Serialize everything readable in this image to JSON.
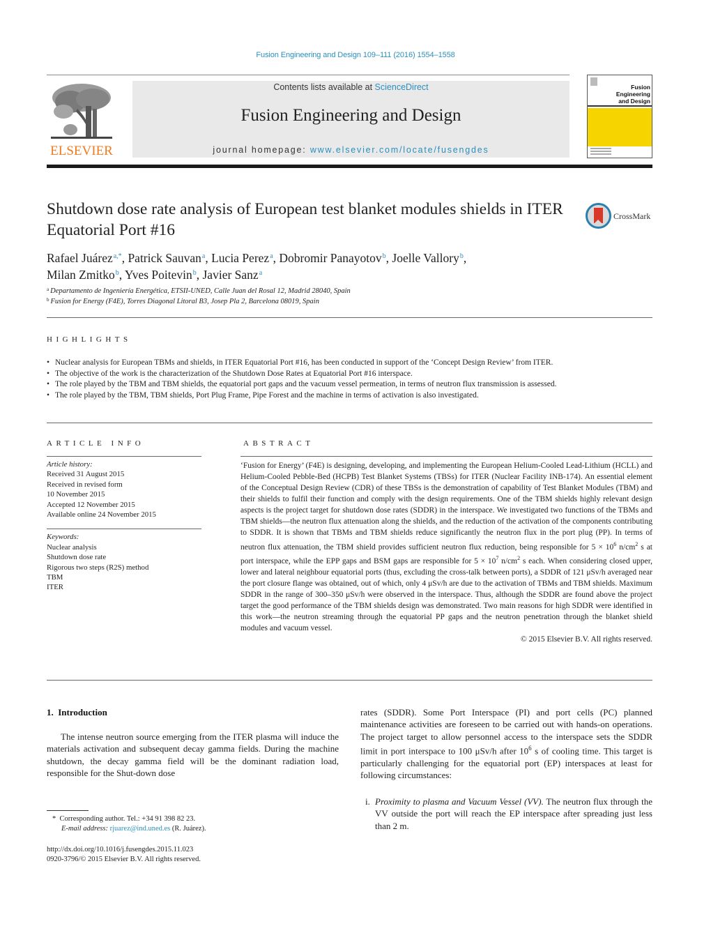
{
  "header": {
    "journal_ref": "Fusion Engineering and Design 109–111 (2016) 1554–1558",
    "contents_prefix": "Contents lists available at ",
    "contents_link": "ScienceDirect",
    "journal_name": "Fusion Engineering and Design",
    "homepage_prefix": "journal homepage: ",
    "homepage_link": "www.elsevier.com/locate/fusengdes",
    "publisher_logo": "ELSEVIER",
    "cover_title_line1": "Fusion Engineering",
    "cover_title_line2": "and Design",
    "colors": {
      "link": "#2a8fbd",
      "elsevier_orange": "#f07a1f",
      "cover_yellow": "#f5d400",
      "banner_gray": "#e9e9e9"
    }
  },
  "article": {
    "title": "Shutdown dose rate analysis of European test blanket modules shields in ITER Equatorial Port #16",
    "crossmark_label": "CrossMark",
    "authors": [
      {
        "name": "Rafael Juárez",
        "affil": "a,*"
      },
      {
        "name": "Patrick Sauvan",
        "affil": "a"
      },
      {
        "name": "Lucia Perez",
        "affil": "a"
      },
      {
        "name": "Dobromir Panayotov",
        "affil": "b"
      },
      {
        "name": "Joelle Vallory",
        "affil": "b"
      },
      {
        "name": "Milan Zmitko",
        "affil": "b"
      },
      {
        "name": "Yves Poitevin",
        "affil": "b"
      },
      {
        "name": "Javier Sanz",
        "affil": "a"
      }
    ],
    "affiliations": [
      {
        "key": "a",
        "text": "Departamento de Ingeniería Energética, ETSII-UNED, Calle Juan del Rosal 12, Madrid 28040, Spain"
      },
      {
        "key": "b",
        "text": "Fusion for Energy (F4E), Torres Diagonal Litoral B3, Josep Pla 2, Barcelona 08019, Spain"
      }
    ]
  },
  "highlights": {
    "heading": "HIGHLIGHTS",
    "items": [
      "Nuclear analysis for European TBMs and shields, in ITER Equatorial Port #16, has been conducted in support of the ‘Concept Design Review’ from ITER.",
      "The objective of the work is the characterization of the Shutdown Dose Rates at Equatorial Port #16 interspace.",
      "The role played by the TBM and TBM shields, the equatorial port gaps and the vacuum vessel permeation, in terms of neutron flux transmission is assessed.",
      "The role played by the TBM, TBM shields, Port Plug Frame, Pipe Forest and the machine in terms of activation is also investigated."
    ]
  },
  "article_info": {
    "heading": "ARTICLE INFO",
    "history_label": "Article history:",
    "history": [
      "Received 31 August 2015",
      "Received in revised form",
      "10 November 2015",
      "Accepted 12 November 2015",
      "Available online 24 November 2015"
    ],
    "keywords_label": "Keywords:",
    "keywords": [
      "Nuclear analysis",
      "Shutdown dose rate",
      "Rigorous two steps (R2S) method",
      "TBM",
      "ITER"
    ]
  },
  "abstract": {
    "heading": "ABSTRACT",
    "text_part1": "‘Fusion for Energy’ (F4E) is designing, developing, and implementing the European Helium-Cooled Lead-Lithium (HCLL) and Helium-Cooled Pebble-Bed (HCPB) Test Blanket Systems (TBSs) for ITER (Nuclear Facility INB-174). An essential element of the Conceptual Design Review (CDR) of these TBSs is the demonstration of capability of Test Blanket Modules (TBM) and their shields to fulfil their function and comply with the design requirements. One of the TBM shields highly relevant design aspects is the project target for shutdown dose rates (SDDR) in the interspace. We investigated two functions of the TBMs and TBM shields—the neutron flux attenuation along the shields, and the reduction of the activation of the components contributing to SDDR. It is shown that TBMs and TBM shields reduce significantly the neutron flux in the port plug (PP). In terms of neutron flux attenuation, the TBM shield provides sufficient neutron flux reduction, being responsible for 5 × 10",
    "exp1": "6",
    "text_part2": " n/cm",
    "exp2": "2",
    "text_part3": " s at port interspace, while the EPP gaps and BSM gaps are responsible for 5 × 10",
    "exp3": "7",
    "text_part4": " n/cm",
    "exp4": "2",
    "text_part5": " s each. When considering closed upper, lower and lateral neighbour equatorial ports (thus, excluding the cross-talk between ports), a SDDR of 121 μSv/h averaged near the port closure flange was obtained, out of which, only 4 μSv/h are due to the activation of TBMs and TBM shields. Maximum SDDR in the range of 300–350 μSv/h were observed in the interspace. Thus, although the SDDR are found above the project target the good performance of the TBM shields design was demonstrated. Two main reasons for high SDDR were identified in this work—the neutron streaming through the equatorial PP gaps and the neutron penetration through the blanket shield modules and vacuum vessel.",
    "copyright": "© 2015 Elsevier B.V. All rights reserved."
  },
  "introduction": {
    "heading": "1.  Introduction",
    "left_para": "The intense neutron source emerging from the ITER plasma will induce the materials activation and subsequent decay gamma fields. During the machine shutdown, the decay gamma field will be the dominant radiation load, responsible for the Shut-down dose",
    "right_para_part1": "rates (SDDR). Some Port Interspace (PI) and port cells (PC) planned maintenance activities are foreseen to be carried out with hands-on operations. The project target to allow personnel access to the interspace sets the SDDR limit in port interspace to 100 μSv/h after 10",
    "right_exp": "6",
    "right_para_part2": " s of cooling time. This target is particularly challenging for the equatorial port (EP) interspaces at least for following circumstances:",
    "list_item_marker": "i.",
    "list_item_italic": "Proximity to plasma and Vacuum Vessel (VV).",
    "list_item_text": " The neutron flux through the VV outside the port will reach the EP interspace after spreading just less than 2 m."
  },
  "footnotes": {
    "marker": "*",
    "corresponding": "Corresponding author. Tel.: +34 91 398 82 23.",
    "email_label": "E-mail address:",
    "email": "rjuarez@ind.uned.es",
    "email_suffix": " (R. Juárez).",
    "doi": "http://dx.doi.org/10.1016/j.fusengdes.2015.11.023",
    "issn_copyright": "0920-3796/© 2015 Elsevier B.V. All rights reserved."
  }
}
